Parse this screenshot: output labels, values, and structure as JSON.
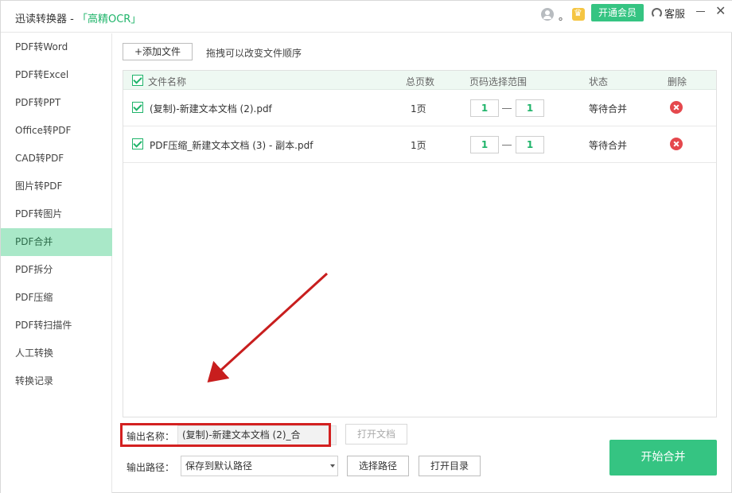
{
  "window": {
    "title_prefix": "迅读转换器 - ",
    "title_brand": "「高精OCR」",
    "dot": "。",
    "vip_label": "开通会员",
    "service_label": "客服",
    "minimize_label": "—",
    "close_label": "✕"
  },
  "sidebar": {
    "items": [
      {
        "label": "PDF转Word"
      },
      {
        "label": "PDF转Excel"
      },
      {
        "label": "PDF转PPT"
      },
      {
        "label": "Office转PDF"
      },
      {
        "label": "CAD转PDF"
      },
      {
        "label": "图片转PDF"
      },
      {
        "label": "PDF转图片"
      },
      {
        "label": "PDF合并",
        "active": true
      },
      {
        "label": "PDF拆分"
      },
      {
        "label": "PDF压缩"
      },
      {
        "label": "PDF转扫描件"
      },
      {
        "label": "人工转换"
      },
      {
        "label": "转换记录"
      }
    ]
  },
  "toolbar": {
    "add_file_label": "+添加文件",
    "hint": "拖拽可以改变文件顺序"
  },
  "table": {
    "headers": {
      "name": "文件名称",
      "pages": "总页数",
      "range": "页码选择范围",
      "status": "状态",
      "delete": "删除"
    },
    "rows": [
      {
        "name": "(复制)-新建文本文档 (2).pdf",
        "pages": "1页",
        "from": "1",
        "to": "1",
        "status": "等待合并"
      },
      {
        "name": "PDF压缩_新建文本文档 (3) - 副本.pdf",
        "pages": "1页",
        "from": "1",
        "to": "1",
        "status": "等待合并"
      }
    ]
  },
  "output": {
    "name_label": "输出名称：",
    "name_value": "(复制)-新建文本文档 (2)_合",
    "open_doc_label": "打开文档",
    "path_label": "输出路径：",
    "path_value": "保存到默认路径",
    "choose_path_label": "选择路径",
    "open_dir_label": "打开目录",
    "start_label": "开始合并"
  },
  "colors": {
    "accent": "#35c482",
    "active_nav": "#a9e8c8",
    "highlight": "#d32020",
    "delete": "#e5484d"
  }
}
